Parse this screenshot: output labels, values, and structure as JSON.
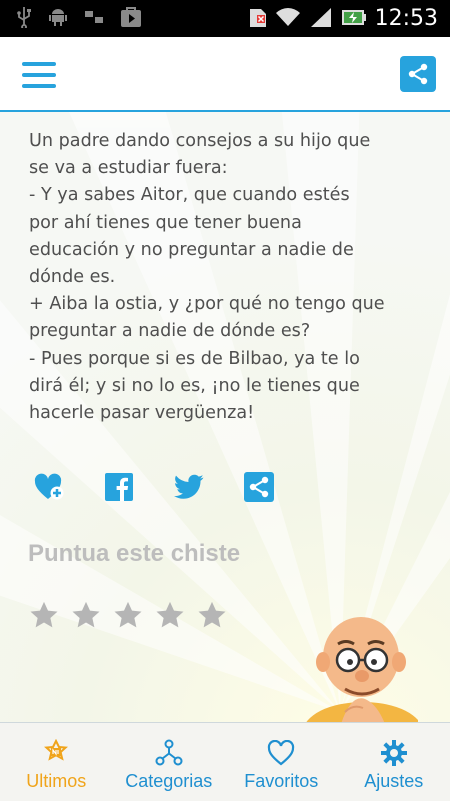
{
  "status_bar": {
    "time": "12:53",
    "icons": [
      "usb-icon",
      "android-debug-icon",
      "sync-icon",
      "play-store-icon",
      "sim-alert-icon",
      "wifi-icon",
      "signal-icon",
      "battery-charging-icon"
    ]
  },
  "app_bar": {
    "menu_icon": "hamburger-menu-icon",
    "share_icon": "share-icon"
  },
  "joke": {
    "text": "Un padre dando consejos a su hijo que\nse va a estudiar fuera:\n- Y ya sabes Aitor, que cuando estés\npor ahí tienes que tener buena\neducación y no preguntar a nadie de\ndónde es.\n+ Aiba la ostia, y ¿por qué no tengo que\npreguntar a nadie de dónde es?\n- Pues porque si es de Bilbao, ya te lo\ndirá él; y si no lo es, ¡no le tienes que\nhacerle pasar vergüenza!"
  },
  "actions": [
    {
      "name": "favorite-add",
      "icon": "heart-plus-icon"
    },
    {
      "name": "facebook-share",
      "icon": "facebook-icon"
    },
    {
      "name": "twitter-share",
      "icon": "twitter-icon"
    },
    {
      "name": "share",
      "icon": "share-icon"
    }
  ],
  "rating": {
    "title": "Puntua este chiste",
    "max_stars": 5,
    "current": 0
  },
  "bottom_nav": [
    {
      "label": "Ultimos",
      "icon": "new-star-badge-icon",
      "active": true
    },
    {
      "label": "Categorias",
      "icon": "network-nodes-icon",
      "active": false
    },
    {
      "label": "Favoritos",
      "icon": "heart-outline-icon",
      "active": false
    },
    {
      "label": "Ajustes",
      "icon": "gear-icon",
      "active": false
    }
  ],
  "colors": {
    "accent": "#27a3dd",
    "active_tab": "#f0a41b",
    "text": "#4f4f4f",
    "rating_title": "#bdbdbd",
    "star_inactive": "#b5b5b5"
  }
}
